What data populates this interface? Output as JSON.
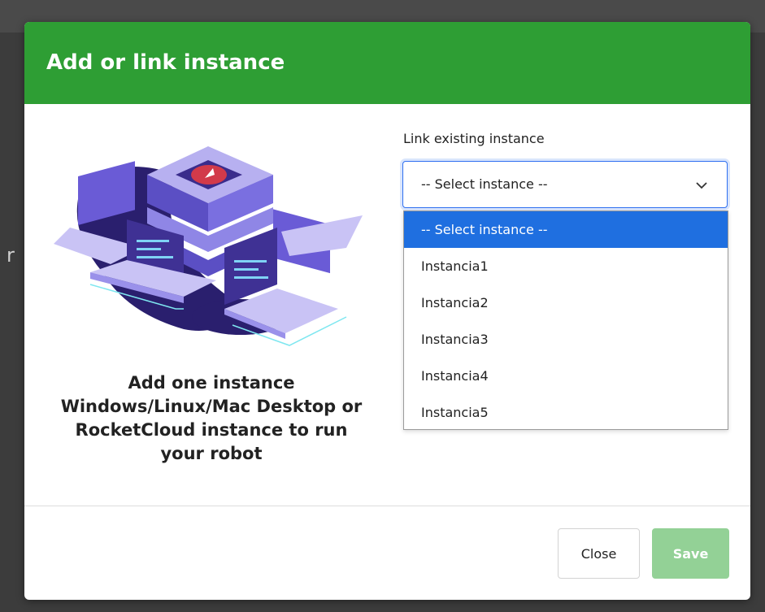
{
  "modal": {
    "title": "Add or link instance",
    "description": "Add one instance Windows/Linux/Mac Desktop or RocketCloud instance to run your robot"
  },
  "backdrop": {
    "fragment": "r"
  },
  "link_field": {
    "label": "Link existing instance",
    "selected_value": "-- Select instance --",
    "options": [
      "-- Select instance --",
      "Instancia1",
      "Instancia2",
      "Instancia3",
      "Instancia4",
      "Instancia5"
    ]
  },
  "footer": {
    "close_label": "Close",
    "save_label": "Save"
  },
  "colors": {
    "header_green": "#2e9e34",
    "highlight_blue": "#1f6fe0",
    "save_disabled": "#93d196"
  },
  "icons": {
    "illustration": "server-laptops-illustration",
    "chevron": "chevron-down-icon"
  }
}
